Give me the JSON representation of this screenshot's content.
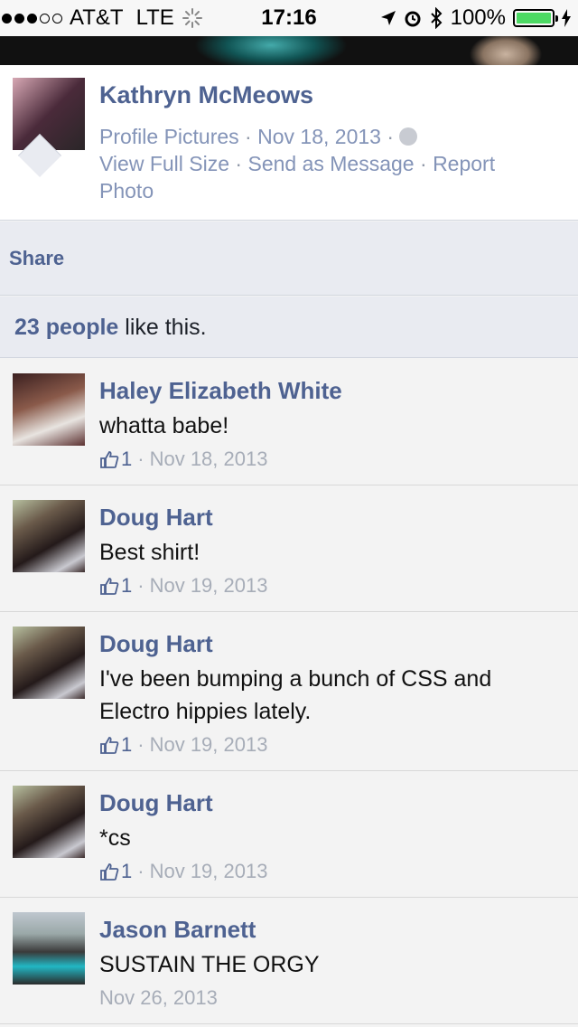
{
  "status_bar": {
    "carrier": "AT&T",
    "network": "LTE",
    "time": "17:16",
    "battery": "100%",
    "battery_level": 1.0,
    "signal_bars": 3,
    "signal_total": 5
  },
  "post": {
    "author": "Kathryn McMeows",
    "album": "Profile Pictures",
    "date": "Nov 18, 2013",
    "actions": {
      "view_full_size": "View Full Size",
      "send_as_message": "Send as Message",
      "report_photo": "Report Photo"
    },
    "privacy_icon": "globe-icon"
  },
  "share_label": "Share",
  "likes": {
    "count_text": "23 people",
    "suffix": " like this."
  },
  "comments": [
    {
      "author": "Haley Elizabeth White",
      "text": "whatta babe!",
      "likes": "1",
      "date": "Nov 18, 2013"
    },
    {
      "author": "Doug Hart",
      "text": "Best shirt!",
      "likes": "1",
      "date": "Nov 19, 2013"
    },
    {
      "author": "Doug Hart",
      "text": "I've been bumping a bunch of CSS and Electro hippies lately.",
      "likes": "1",
      "date": "Nov 19, 2013"
    },
    {
      "author": "Doug Hart",
      "text": "*cs",
      "likes": "1",
      "date": "Nov 19, 2013"
    },
    {
      "author": "Jason Barnett",
      "text": "SUSTAIN THE ORGY",
      "likes": "",
      "date": "Nov 26, 2013"
    }
  ],
  "colors": {
    "link": "#4e6291",
    "meta": "#8494b8",
    "battery": "#4cd964"
  }
}
